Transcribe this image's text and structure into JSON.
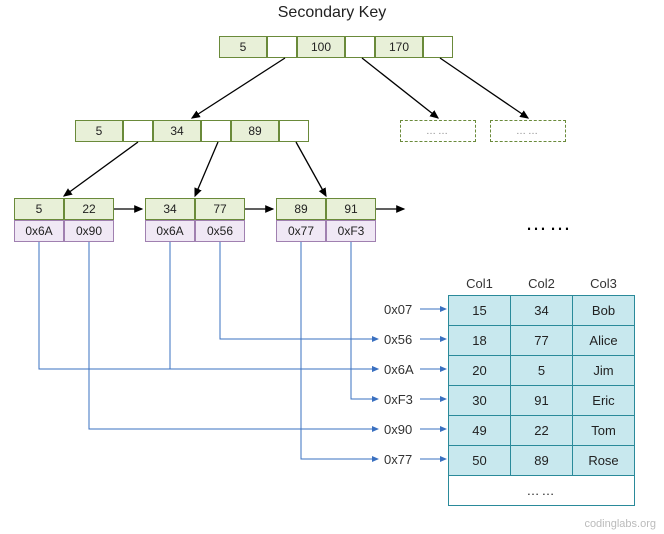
{
  "title": "Secondary Key",
  "tree": {
    "root": {
      "keys": [
        "5",
        "100",
        "170"
      ]
    },
    "internal": {
      "keys": [
        "5",
        "34",
        "89"
      ]
    },
    "leaves": [
      {
        "keys": [
          "5",
          "22"
        ],
        "ptrs": [
          "0x6A",
          "0x90"
        ]
      },
      {
        "keys": [
          "34",
          "77"
        ],
        "ptrs": [
          "0x6A",
          "0x56"
        ]
      },
      {
        "keys": [
          "89",
          "91"
        ],
        "ptrs": [
          "0x77",
          "0xF3"
        ]
      }
    ]
  },
  "placeholder_dots": "……",
  "leaves_more": "……",
  "address_list": [
    "0x07",
    "0x56",
    "0x6A",
    "0xF3",
    "0x90",
    "0x77"
  ],
  "table": {
    "headers": [
      "Col1",
      "Col2",
      "Col3"
    ],
    "rows": [
      [
        "15",
        "34",
        "Bob"
      ],
      [
        "18",
        "77",
        "Alice"
      ],
      [
        "20",
        "5",
        "Jim"
      ],
      [
        "30",
        "91",
        "Eric"
      ],
      [
        "49",
        "22",
        "Tom"
      ],
      [
        "50",
        "89",
        "Rose"
      ]
    ],
    "more": "……"
  },
  "watermark": "codinglabs.org"
}
